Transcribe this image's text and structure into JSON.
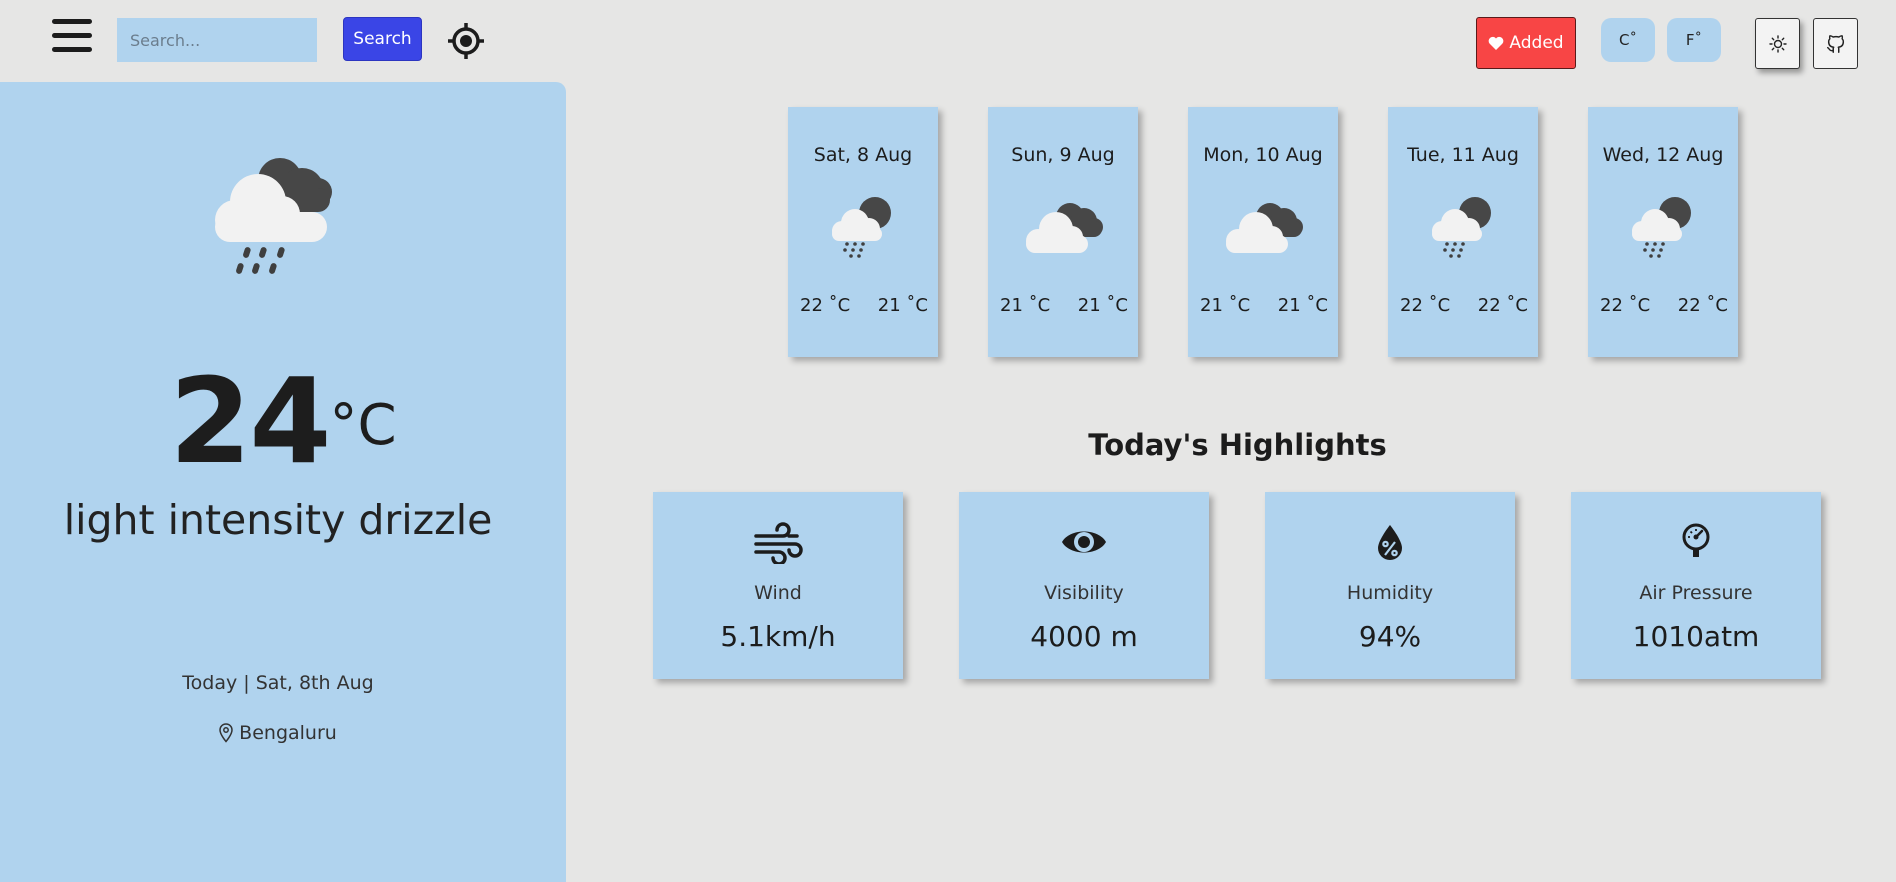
{
  "header": {
    "search_placeholder": "Search...",
    "search_label": "Search",
    "added_label": "Added",
    "unit_c": "C˚",
    "unit_f": "F˚"
  },
  "current": {
    "temp": "24",
    "unit": "°C",
    "description": "light intensity drizzle",
    "date": "Today | Sat, 8th Aug",
    "location": "Bengaluru"
  },
  "forecast": [
    {
      "date": "Sat, 8 Aug",
      "max": "22 ˚C",
      "min": "21 ˚C",
      "icon": "drizzle-icon"
    },
    {
      "date": "Sun, 9 Aug",
      "max": "21 ˚C",
      "min": "21 ˚C",
      "icon": "cloudy-icon"
    },
    {
      "date": "Mon, 10 Aug",
      "max": "21 ˚C",
      "min": "21 ˚C",
      "icon": "cloudy-icon"
    },
    {
      "date": "Tue, 11 Aug",
      "max": "22 ˚C",
      "min": "22 ˚C",
      "icon": "drizzle-icon"
    },
    {
      "date": "Wed, 12 Aug",
      "max": "22 ˚C",
      "min": "22 ˚C",
      "icon": "drizzle-icon"
    }
  ],
  "highlights": {
    "title": "Today's Highlights",
    "items": [
      {
        "label": "Wind",
        "value": "5.1km/h",
        "icon": "wind-icon"
      },
      {
        "label": "Visibility",
        "value": "4000 m",
        "icon": "eye-icon"
      },
      {
        "label": "Humidity",
        "value": "94%",
        "icon": "humidity-icon"
      },
      {
        "label": "Air Pressure",
        "value": "1010atm",
        "icon": "gauge-icon"
      }
    ]
  },
  "colors": {
    "background": "#e6e6e5",
    "panel": "#b0d3ee",
    "search_button": "#3a45e6",
    "added_button": "#f84545"
  }
}
